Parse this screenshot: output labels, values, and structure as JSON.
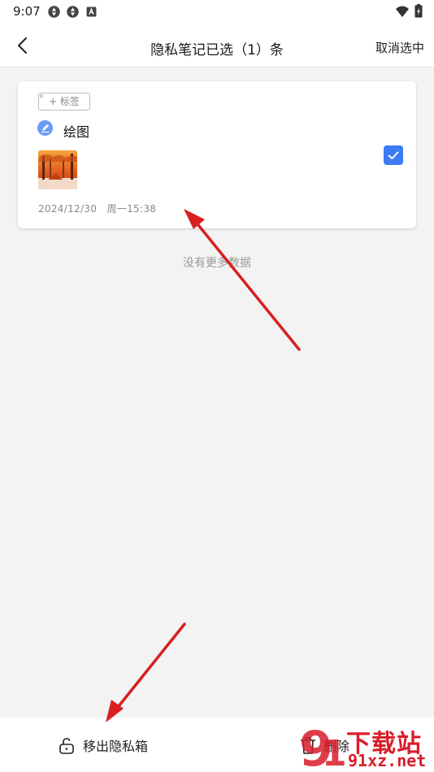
{
  "status_bar": {
    "time": "9:07",
    "icons": [
      "sync-icon",
      "sync-icon",
      "a-icon",
      "wifi-icon",
      "battery-icon"
    ]
  },
  "app_bar": {
    "title": "隐私笔记已选（1）条",
    "cancel_selection_label": "取消选中"
  },
  "note": {
    "tag_label": "+ 标签",
    "type_icon": "pencil-icon",
    "title": "绘图",
    "thumbnail_icon": "drawing-thumbnail",
    "date": "2024/12/30",
    "time": "周一15:38",
    "selected": true
  },
  "list_footer": "没有更多数据",
  "bottom_bar": {
    "move_out_label": "移出隐私箱",
    "delete_label": "删除"
  },
  "watermark": {
    "big_text": "下载站",
    "url_text": "91xz.net"
  },
  "colors": {
    "accent": "#3d7bf4",
    "annotation_arrow": "#d81f1f",
    "watermark": "#d91d2a"
  }
}
